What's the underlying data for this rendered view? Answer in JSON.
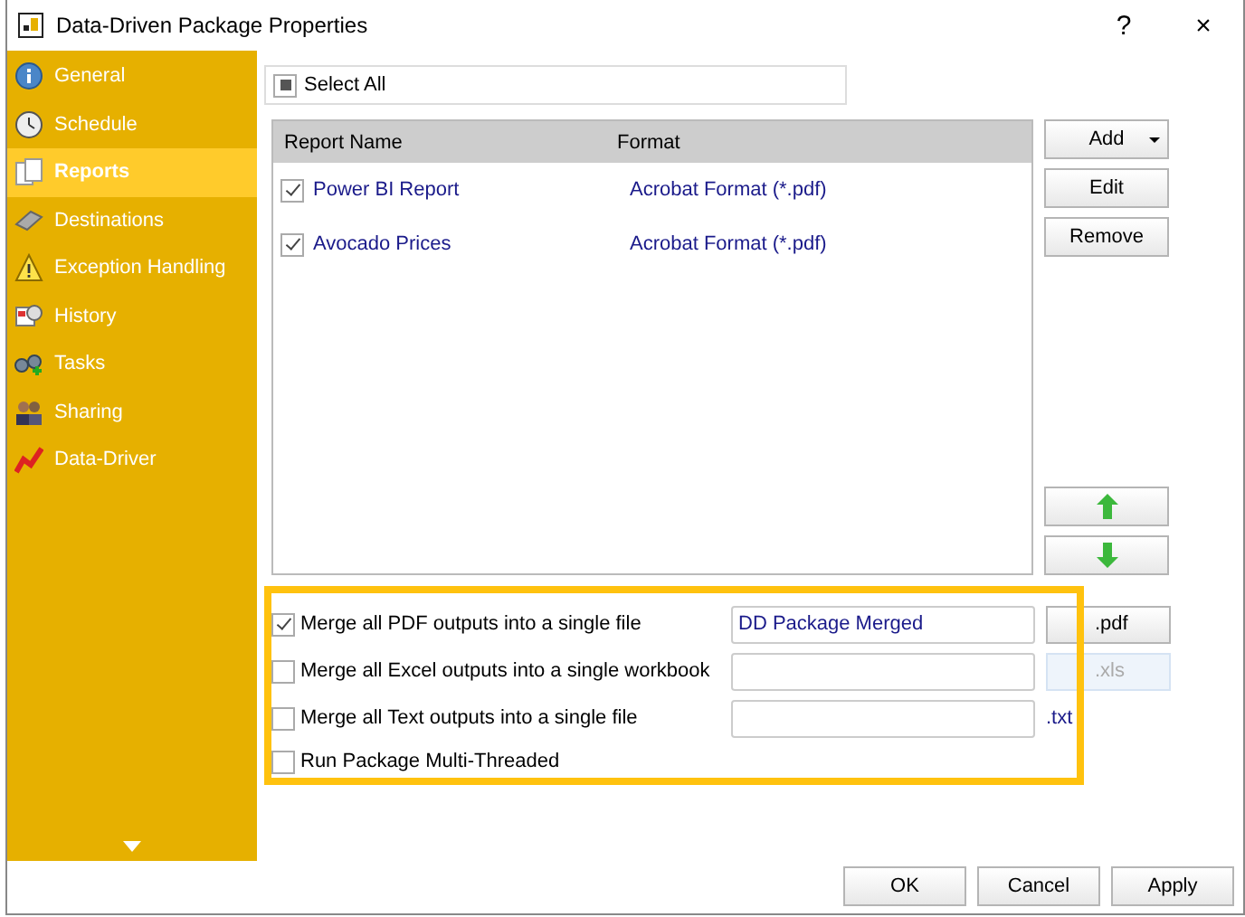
{
  "window": {
    "title": "Data-Driven Package Properties",
    "help": "?",
    "close": "×"
  },
  "sidebar": {
    "items": [
      {
        "label": "General",
        "selected": false
      },
      {
        "label": "Schedule",
        "selected": false
      },
      {
        "label": "Reports",
        "selected": true
      },
      {
        "label": "Destinations",
        "selected": false
      },
      {
        "label": "Exception Handling",
        "selected": false
      },
      {
        "label": "History",
        "selected": false
      },
      {
        "label": "Tasks",
        "selected": false
      },
      {
        "label": "Sharing",
        "selected": false
      },
      {
        "label": "Data-Driver",
        "selected": false
      }
    ]
  },
  "select_all": {
    "label": "Select All",
    "indeterminate": true
  },
  "table": {
    "columns": [
      "Report Name",
      "Format"
    ],
    "rows": [
      {
        "checked": true,
        "name": "Power BI Report",
        "format": "Acrobat Format (*.pdf)"
      },
      {
        "checked": true,
        "name": "Avocado Prices",
        "format": "Acrobat Format (*.pdf)"
      }
    ]
  },
  "side_buttons": [
    "Add",
    "Edit",
    "Remove"
  ],
  "options": [
    {
      "kind": "merge",
      "label": "Merge all PDF outputs into a single file",
      "checked": true,
      "value": "DD Package Merged",
      "extension": {
        "kind": "button",
        "label": ".pdf",
        "disabled": false
      }
    },
    {
      "kind": "merge",
      "label": "Merge all Excel outputs into a single workbook",
      "checked": false,
      "extension": {
        "kind": "button",
        "label": ".xls",
        "disabled": true
      }
    },
    {
      "kind": "merge",
      "label": "Merge all Text outputs into a single file",
      "checked": false,
      "extension": {
        "kind": "label",
        "label": ".txt"
      }
    },
    {
      "kind": "plain",
      "label": "Run Package Multi-Threaded",
      "checked": false
    }
  ],
  "footer_buttons": [
    "OK",
    "Cancel",
    "Apply"
  ]
}
